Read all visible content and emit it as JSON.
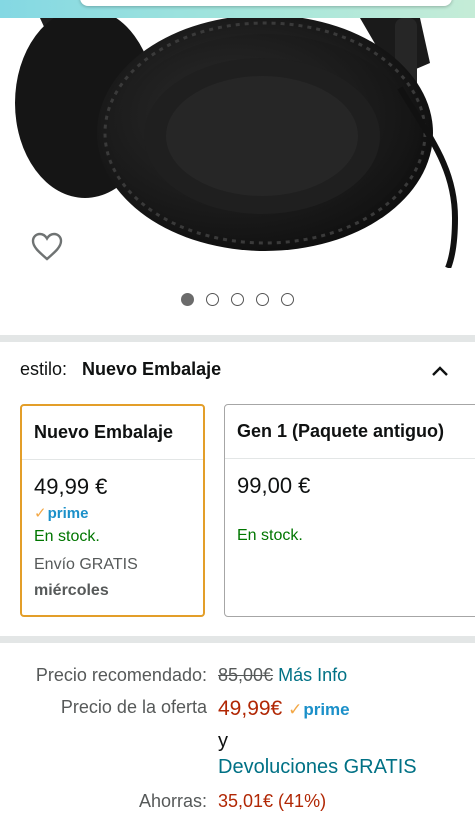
{
  "variant": {
    "label": "estilo:",
    "selected": "Nuevo Embalaje",
    "options": [
      {
        "name": "Nuevo Embalaje",
        "price": "49,99 €",
        "badge": "prime",
        "stock": "En stock.",
        "shipping": "Envío GRATIS",
        "delivery": "miércoles"
      },
      {
        "name": "Gen 1 (Paquete antiguo)",
        "price": "99,00 €",
        "stock": "En stock."
      }
    ]
  },
  "carousel": {
    "total": 5,
    "active": 1
  },
  "pricing": {
    "list_price_label": "Precio recomendado:",
    "list_price": "85,00€",
    "more_info": "Más Info",
    "deal_price_label": "Precio de la oferta",
    "deal_price": "49,99€",
    "badge": "prime",
    "conjunction": "y",
    "returns": "Devoluciones GRATIS",
    "savings_label": "Ahorras:",
    "savings": "35,01€ (41%)"
  },
  "icons": {
    "wishlist": "heart-icon",
    "collapse": "chevron-up-icon",
    "prime": "prime-check-icon"
  },
  "colors": {
    "accent_selected": "#e39e29",
    "prime_blue": "#1b90c9",
    "prime_check": "#f3a847",
    "in_stock": "#007600",
    "link": "#007185",
    "price_red": "#b12704"
  }
}
